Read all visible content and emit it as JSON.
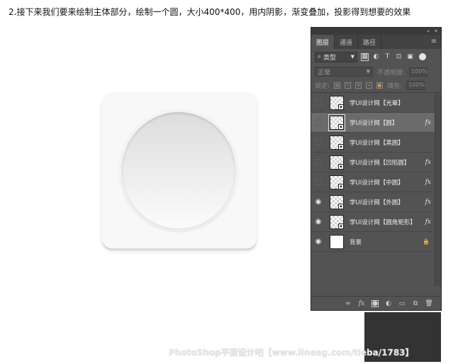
{
  "instruction": "2.接下来我们要来绘制主体部分，绘制一个圆，大小400*400，用内阴影，渐变叠加，投影得到想要的效果",
  "panel": {
    "tabs": [
      {
        "label": "图层",
        "active": true
      },
      {
        "label": "通道",
        "active": false
      },
      {
        "label": "路径",
        "active": false
      }
    ],
    "filter": {
      "label": "类型"
    },
    "blend_mode": "正常",
    "opacity_label": "不透明度:",
    "opacity_value": "100%",
    "lock_label": "锁定:",
    "fill_label": "填充:",
    "fill_value": "100%",
    "layers": [
      {
        "name": "学UI设计网【光晕】",
        "visible": false,
        "fx": false,
        "selected": false
      },
      {
        "name": "学UI设计网【圆】",
        "visible": false,
        "fx": true,
        "selected": true
      },
      {
        "name": "学UI设计网【黑圆】",
        "visible": false,
        "fx": false,
        "selected": false
      },
      {
        "name": "学UI设计网【凹陷圆】",
        "visible": false,
        "fx": true,
        "selected": false
      },
      {
        "name": "学UI设计网【中圆】",
        "visible": false,
        "fx": true,
        "selected": false
      },
      {
        "name": "学UI设计网【外圆】",
        "visible": true,
        "fx": true,
        "selected": false
      },
      {
        "name": "学UI设计网【圆角矩形】",
        "visible": true,
        "fx": true,
        "selected": false
      },
      {
        "name": "背景",
        "visible": true,
        "fx": false,
        "selected": false,
        "background": true
      }
    ],
    "fx_label": "fx"
  },
  "watermark": "PhotoShop平面设计吧【www.lineeg.com/tieba/1783】"
}
